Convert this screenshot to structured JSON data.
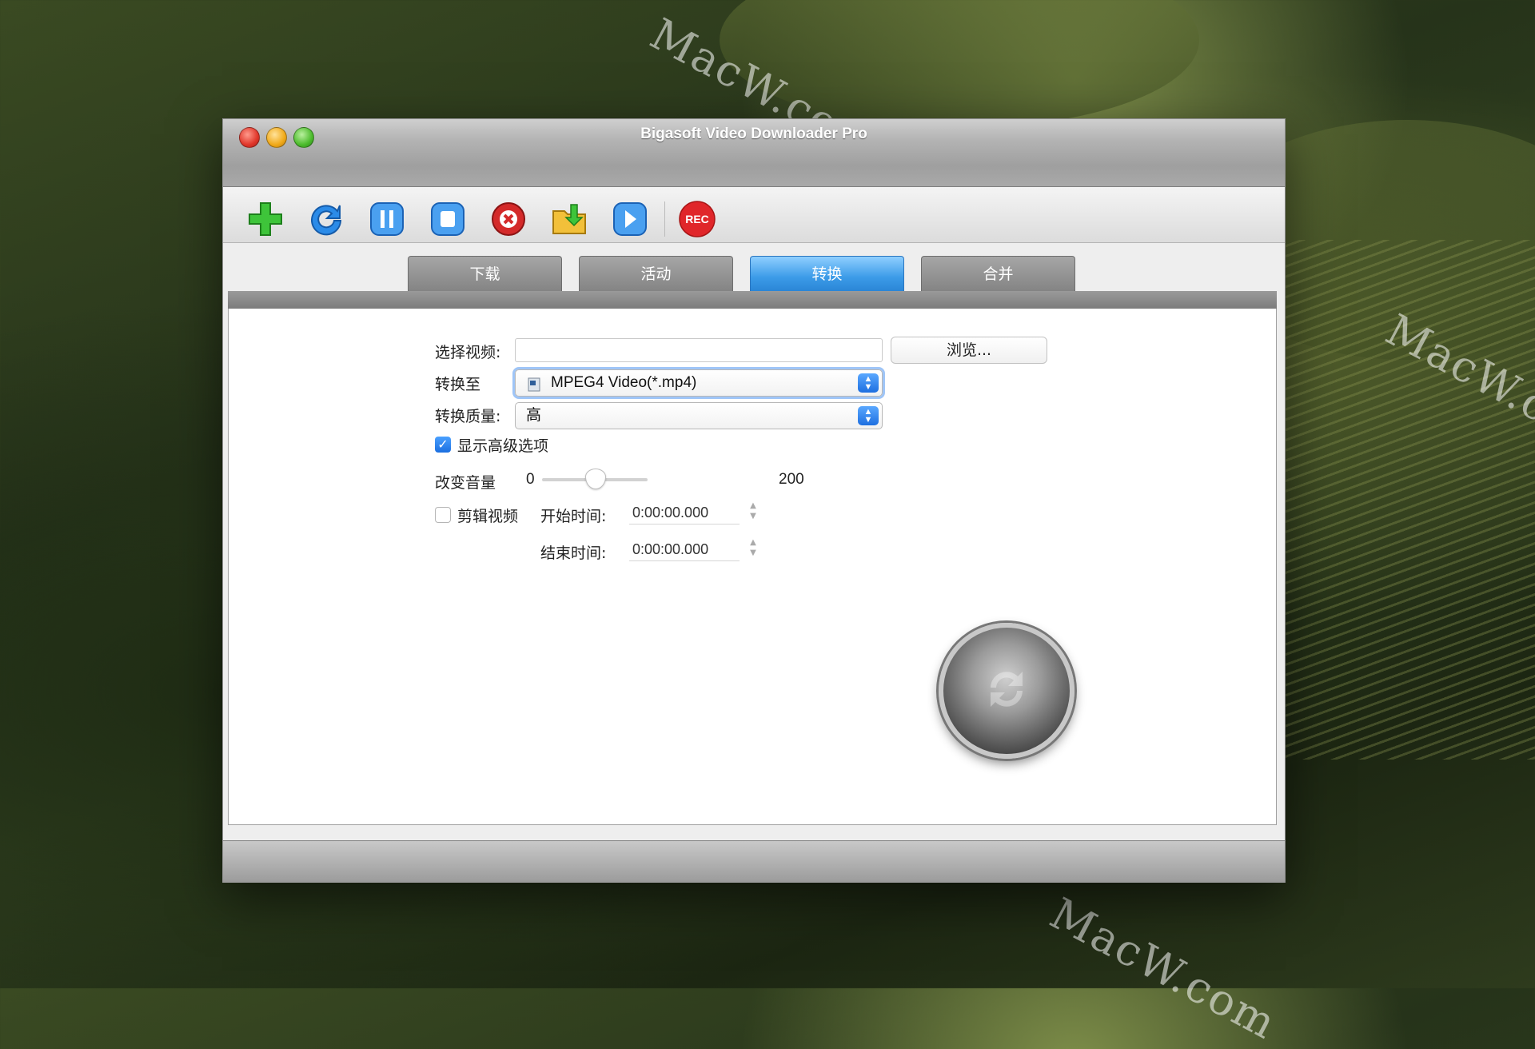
{
  "window": {
    "title": "Bigasoft Video Downloader Pro"
  },
  "watermarks": [
    "MacW.com",
    "MacW.com",
    "MacW.com",
    "MacW.com"
  ],
  "toolbar": {
    "buttons": [
      {
        "name": "add-icon"
      },
      {
        "name": "refresh-icon"
      },
      {
        "name": "pause-icon"
      },
      {
        "name": "stop-icon"
      },
      {
        "name": "delete-icon"
      },
      {
        "name": "open-folder-icon"
      },
      {
        "name": "play-icon"
      },
      {
        "name": "record-icon",
        "label": "REC"
      }
    ]
  },
  "tabs": [
    {
      "label": "下载",
      "active": false
    },
    {
      "label": "活动",
      "active": false
    },
    {
      "label": "转换",
      "active": true
    },
    {
      "label": "合并",
      "active": false
    }
  ],
  "form": {
    "select_video_label": "选择视频:",
    "select_video_value": "",
    "browse_label": "浏览...",
    "convert_to_label": "转换至",
    "convert_to_value": "MPEG4 Video(*.mp4)",
    "quality_label": "转换质量:",
    "quality_value": "高",
    "advanced_label": "显示高级选项",
    "advanced_checked": true,
    "volume_label": "改变音量",
    "volume_min": "0",
    "volume_max": "200",
    "volume_value_fraction": 0.5,
    "trim_label": "剪辑视频",
    "trim_checked": false,
    "start_label": "开始时间:",
    "start_value": "0:00:00.000",
    "end_label": "结束时间:",
    "end_value": "0:00:00.000"
  },
  "colors": {
    "active_tab": "#3c9be8",
    "rec_red": "#e0262a",
    "checkbox_blue": "#1b6fe0"
  }
}
